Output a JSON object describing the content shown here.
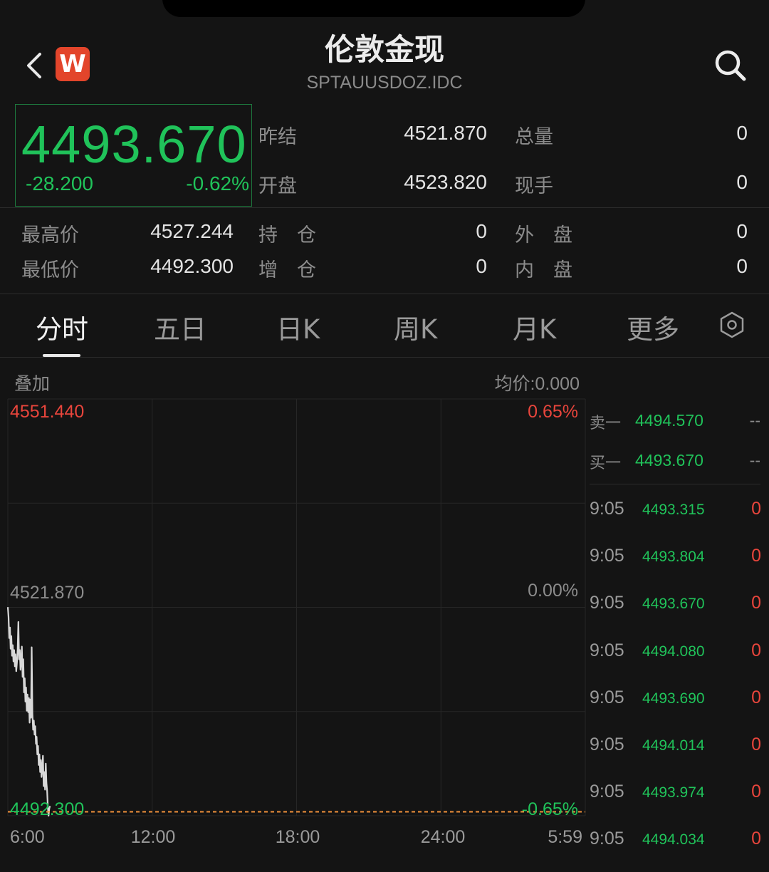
{
  "header": {
    "title": "伦敦金现",
    "symbol": "SPTAUUSDOZ.IDC",
    "logo_text": "W"
  },
  "quote": {
    "price": "4493.670",
    "change": "-28.200",
    "change_pct": "-0.62%",
    "color": "#20c35a"
  },
  "stats": {
    "prev_settle_label": "昨结",
    "prev_settle": "4521.870",
    "total_vol_label": "总量",
    "total_vol": "0",
    "open_label": "开盘",
    "open": "4523.820",
    "cur_hand_label": "现手",
    "cur_hand": "0",
    "high_label": "最高价",
    "high": "4527.244",
    "hold_label": "持　仓",
    "hold": "0",
    "outer_label": "外　盘",
    "outer": "0",
    "low_label": "最低价",
    "low": "4492.300",
    "add_label": "增　仓",
    "add": "0",
    "inner_label": "内　盘",
    "inner": "0"
  },
  "tabs": [
    "分时",
    "五日",
    "日K",
    "周K",
    "月K",
    "更多"
  ],
  "chart_header": {
    "overlay_label": "叠加",
    "avg_label": "均价:0.000"
  },
  "chart_data": {
    "type": "line",
    "y_top": "4551.440",
    "y_mid": "4521.870",
    "y_bottom": "4492.300",
    "pct_top": "0.65%",
    "pct_mid": "0.00%",
    "pct_bottom": "-0.65%",
    "x_ticks": [
      "6:00",
      "12:00",
      "18:00",
      "24:00",
      "5:59"
    ],
    "ylim": [
      4492.3,
      4551.44
    ],
    "prev_close": 4521.87,
    "series": [
      {
        "color": "#d8d8d8",
        "x_minutes": [
          0,
          1,
          2,
          3,
          4,
          5,
          6,
          7,
          8,
          9,
          10,
          11,
          12,
          13,
          14,
          15,
          16,
          17,
          18,
          19,
          20,
          21,
          22,
          23,
          24,
          25,
          26,
          27,
          28,
          29,
          30,
          31,
          32,
          33,
          34,
          35,
          36,
          37,
          38,
          39,
          40,
          41,
          42,
          43,
          44,
          45,
          46,
          47,
          48,
          49,
          50,
          51,
          52,
          53,
          54,
          55,
          56,
          57,
          58,
          59,
          60
        ],
        "values": [
          4521.9,
          4520.5,
          4517.5,
          4519.0,
          4516.0,
          4517.8,
          4515.0,
          4516.5,
          4514.2,
          4515.8,
          4513.5,
          4515.2,
          4512.8,
          4514.0,
          4515.9,
          4519.8,
          4514.5,
          4515.8,
          4513.0,
          4514.2,
          4516.3,
          4512.0,
          4514.5,
          4509.8,
          4511.8,
          4508.5,
          4510.5,
          4507.2,
          4509.5,
          4507.0,
          4509.0,
          4505.5,
          4508.8,
          4506.2,
          4516.2,
          4506.8,
          4504.5,
          4505.8,
          4503.8,
          4505.0,
          4502.5,
          4503.5,
          4501.0,
          4502.2,
          4499.5,
          4501.0,
          4498.5,
          4500.2,
          4497.8,
          4499.0,
          4500.8,
          4496.5,
          4498.5,
          4496.0,
          4499.7,
          4497.0,
          4495.8,
          4493.5,
          4492.3,
          4493.3,
          4493.67
        ]
      }
    ],
    "last_price": 4493.67,
    "last_price_line_color": "#f0913a"
  },
  "orderbook": {
    "ask_label": "卖一",
    "ask": "4494.570",
    "ask_vol": "--",
    "bid_label": "买一",
    "bid": "4493.670",
    "bid_vol": "--"
  },
  "trades": [
    {
      "time": "9:05",
      "price": "4493.315",
      "vol": "0"
    },
    {
      "time": "9:05",
      "price": "4493.804",
      "vol": "0"
    },
    {
      "time": "9:05",
      "price": "4493.670",
      "vol": "0"
    },
    {
      "time": "9:05",
      "price": "4494.080",
      "vol": "0"
    },
    {
      "time": "9:05",
      "price": "4493.690",
      "vol": "0"
    },
    {
      "time": "9:05",
      "price": "4494.014",
      "vol": "0"
    },
    {
      "time": "9:05",
      "price": "4493.974",
      "vol": "0"
    },
    {
      "time": "9:05",
      "price": "4494.034",
      "vol": "0"
    }
  ]
}
